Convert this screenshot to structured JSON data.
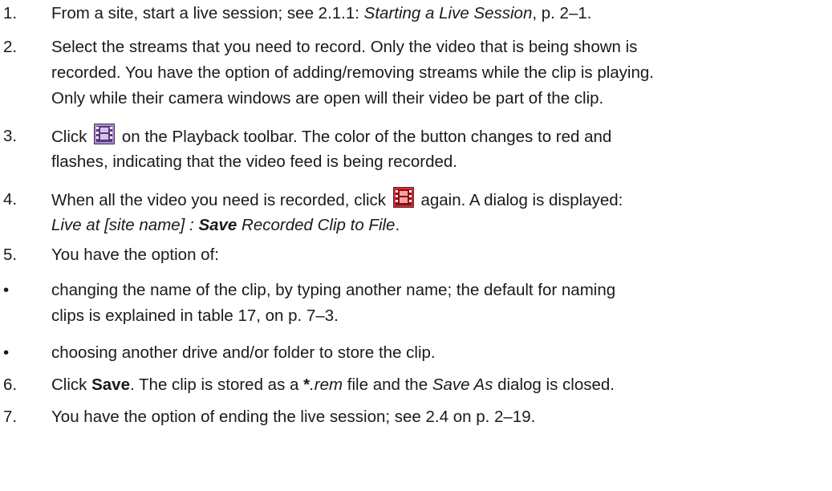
{
  "steps": [
    {
      "num": "1.",
      "intro": "From a site, start a live session; see 2.1.1: ",
      "ref_title": "Starting a Live Session",
      "ref_page": ", p. 2–1."
    },
    {
      "num": "2.",
      "lines": [
        "Select the streams that you need to record. Only the video that is being shown is",
        "recorded. You have the option of adding/removing streams while the clip is playing.",
        "Only while their camera windows are open will their video be part of the clip."
      ]
    },
    {
      "num": "3.",
      "before_icon": "Click",
      "icon": "record-clip-button-icon",
      "after_icon": "on the Playback toolbar. The color of the button changes to red and",
      "line2": "flashes, indicating that the video feed is being recorded."
    },
    {
      "num": "4.",
      "before_icon": "When all the video you need is recorded, click",
      "icon": "record-clip-active-icon",
      "after_icon": "again. A dialog is displayed:",
      "line2_a": "Live at [site name] : ",
      "line2_b": "Save",
      "line2_c": " Recorded Clip to File",
      "line2_end": "."
    },
    {
      "num": "5.",
      "text": "You have the option of:"
    },
    {
      "bullet": "•",
      "line1": "changing the name of the clip, by typing another name; the default for naming",
      "line2": "clips is explained in table 17, on p. 7–3."
    },
    {
      "bullet": "•",
      "text": "choosing another drive and/or folder to store the clip."
    },
    {
      "num": "6.",
      "pre": "Click ",
      "bold": "Save",
      "mid": ". The clip is stored as a ",
      "ext_bold": "*",
      "ext_ital": ".rem",
      "mid2": " file and the ",
      "dlg": "Save As",
      "end": " dialog is closed."
    },
    {
      "num": "7.",
      "text": "You have the option of ending the live session; see 2.4 on p. 2–19."
    }
  ],
  "colors": {
    "text": "#1a1a1a",
    "icon_bg_normal": "#b38bd8",
    "icon_bg_active": "#e8232a",
    "icon_frame": "#3a3a3a"
  }
}
